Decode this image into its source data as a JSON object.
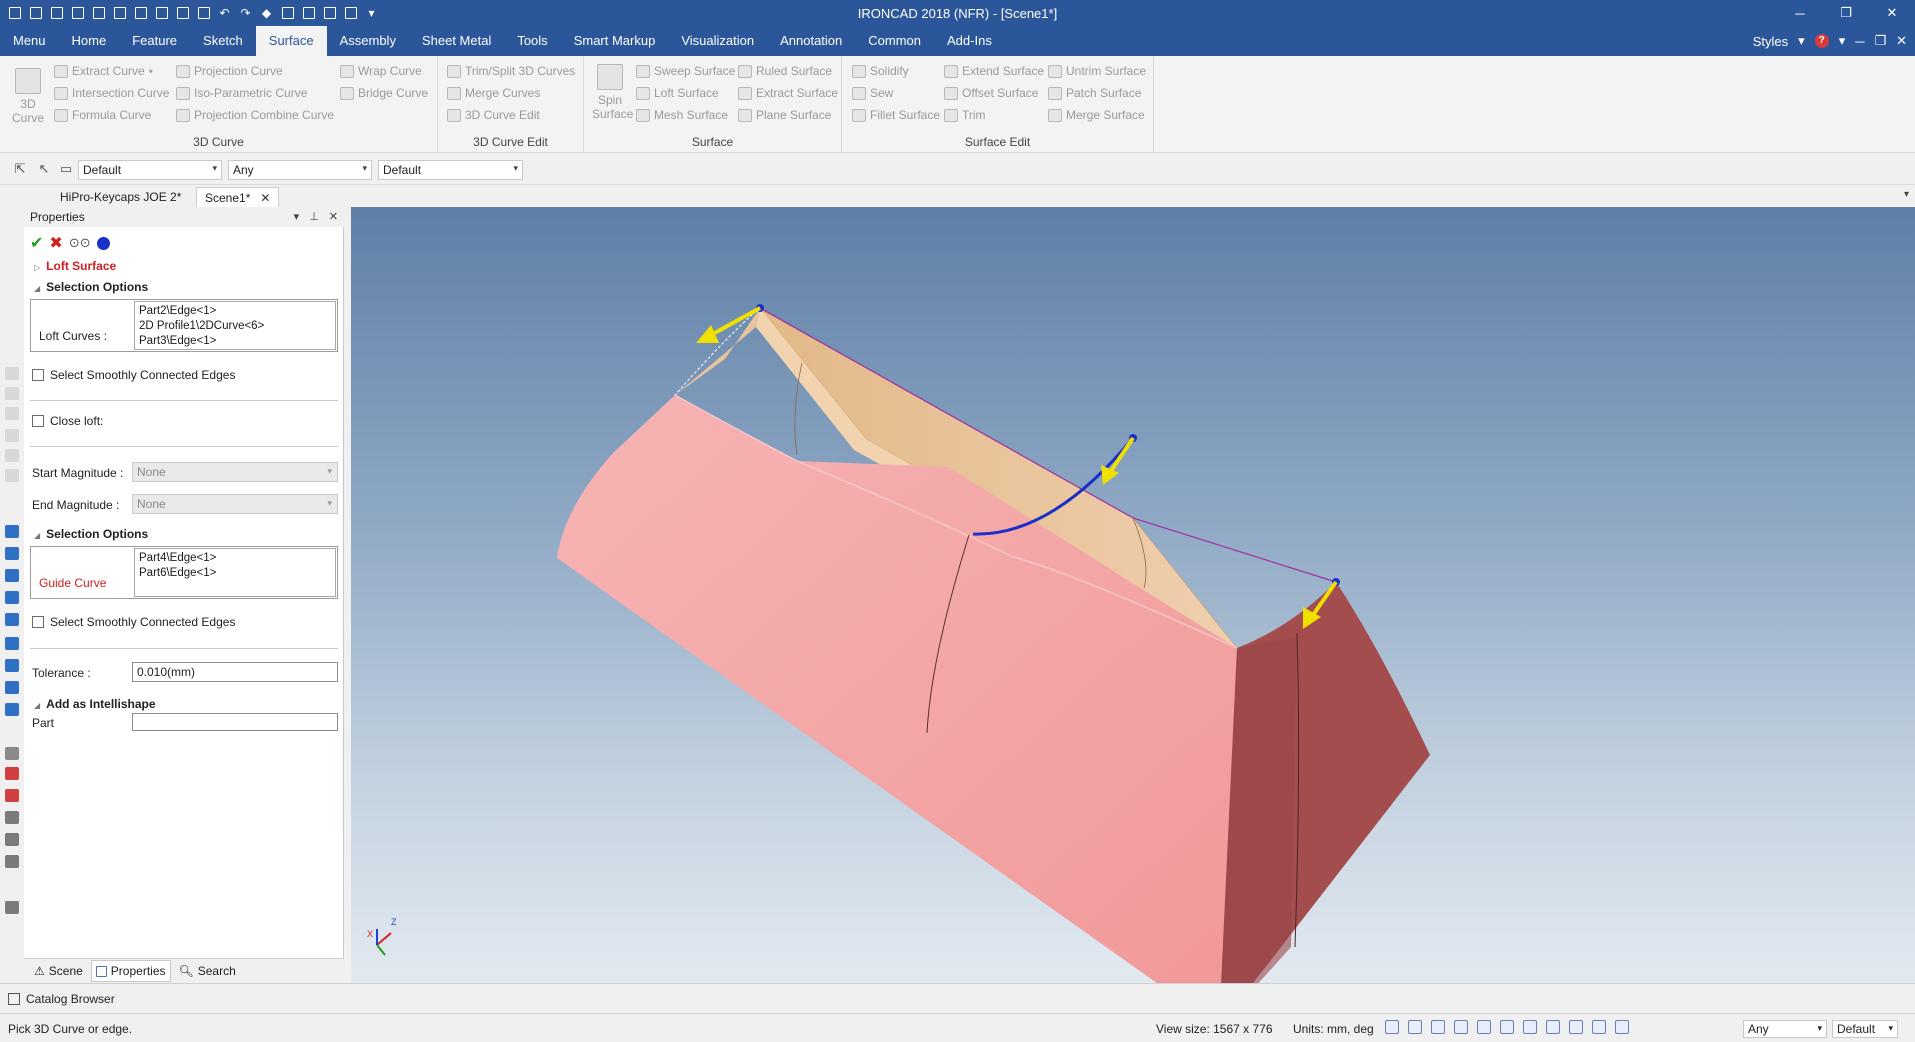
{
  "window": {
    "title": "IRONCAD 2018 (NFR) - [Scene1*]"
  },
  "menu_tabs": [
    "Menu",
    "Home",
    "Feature",
    "Sketch",
    "Surface",
    "Assembly",
    "Sheet Metal",
    "Tools",
    "Smart Markup",
    "Visualization",
    "Annotation",
    "Common",
    "Add-Ins"
  ],
  "active_tab": "Surface",
  "styles_label": "Styles",
  "ribbon": {
    "curve3d": {
      "label": "3D Curve",
      "big_button": "3D Curve",
      "items": [
        "Extract Curve",
        "Intersection Curve",
        "Formula Curve",
        "Projection Curve",
        "Iso-Parametric Curve",
        "Projection Combine Curve",
        "Wrap Curve",
        "Bridge Curve"
      ]
    },
    "curve_edit": {
      "label": "3D Curve Edit",
      "items": [
        "Trim/Split 3D Curves",
        "Merge Curves",
        "3D Curve Edit"
      ]
    },
    "surface": {
      "label": "Surface",
      "big_button": "Spin Surface",
      "items": [
        "Sweep Surface",
        "Loft Surface",
        "Mesh Surface",
        "Ruled Surface",
        "Extract Surface",
        "Plane Surface"
      ]
    },
    "surface_edit": {
      "label": "Surface Edit",
      "items": [
        "Solidify",
        "Sew",
        "Fillet Surface",
        "Extend Surface",
        "Offset Surface",
        "Trim",
        "Untrim Surface",
        "Patch Surface",
        "Merge Surface"
      ]
    }
  },
  "selection_toolbar": {
    "combo1": "Default",
    "combo2": "Any",
    "combo3": "Default"
  },
  "doc_tabs": [
    "HiPro-Keycaps JOE 2*",
    "Scene1*"
  ],
  "properties": {
    "header": "Properties",
    "feature_title": "Loft Surface",
    "section1_title": "Selection Options",
    "loft_curves_label": "Loft Curves :",
    "loft_curves": [
      "Part2\\Edge<1>",
      "2D Profile1\\2DCurve<6>",
      "Part3\\Edge<1>"
    ],
    "select_smooth_1": "Select Smoothly Connected Edges",
    "close_loft": "Close loft:",
    "start_magnitude_label": "Start Magnitude :",
    "start_magnitude_value": "None",
    "end_magnitude_label": "End Magnitude :",
    "end_magnitude_value": "None",
    "section2_title": "Selection Options",
    "guide_curve_label": "Guide Curve",
    "guide_curves": [
      "Part4\\Edge<1>",
      "Part6\\Edge<1>"
    ],
    "select_smooth_2": "Select Smoothly Connected Edges",
    "tolerance_label": "Tolerance :",
    "tolerance_value": "0.010(mm)",
    "intellishape_title": "Add as Intellishape",
    "part_label": "Part",
    "part_value": ""
  },
  "panel_tabs": [
    "Scene",
    "Properties",
    "Search"
  ],
  "active_panel_tab": "Properties",
  "catalog_browser": "Catalog Browser",
  "statusbar": {
    "message": "Pick 3D Curve or edge.",
    "view_size": "View size: 1567 x 776",
    "units": "Units: mm, deg",
    "combo_any": "Any",
    "combo_default": "Default"
  },
  "axis_labels": {
    "x": "X",
    "z": "Z"
  },
  "colors": {
    "accent": "#2b579a",
    "surface_pink": "#f4a0a0",
    "surface_inside": "#e9c49d",
    "handle_yellow": "#f0e000",
    "curve_blue": "#1a30c8"
  }
}
